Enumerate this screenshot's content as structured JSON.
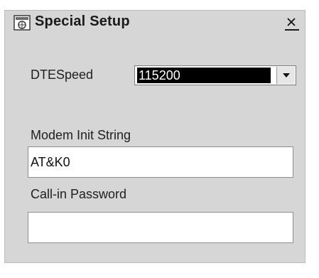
{
  "window": {
    "title": "Special Setup",
    "close_glyph": "×",
    "icon": "app-window-icon"
  },
  "dte_speed": {
    "label": "DTESpeed",
    "selected_value": "115200",
    "arrow_icon": "chevron-down-icon"
  },
  "modem_init": {
    "label": "Modem Init String",
    "value": "AT&K0"
  },
  "call_in_password": {
    "label": "Call-in Password",
    "value": ""
  },
  "colors": {
    "window_bg": "#d6d6d6",
    "selection_bg": "#000000",
    "selection_fg": "#ffffff",
    "field_bg": "#ffffff"
  }
}
